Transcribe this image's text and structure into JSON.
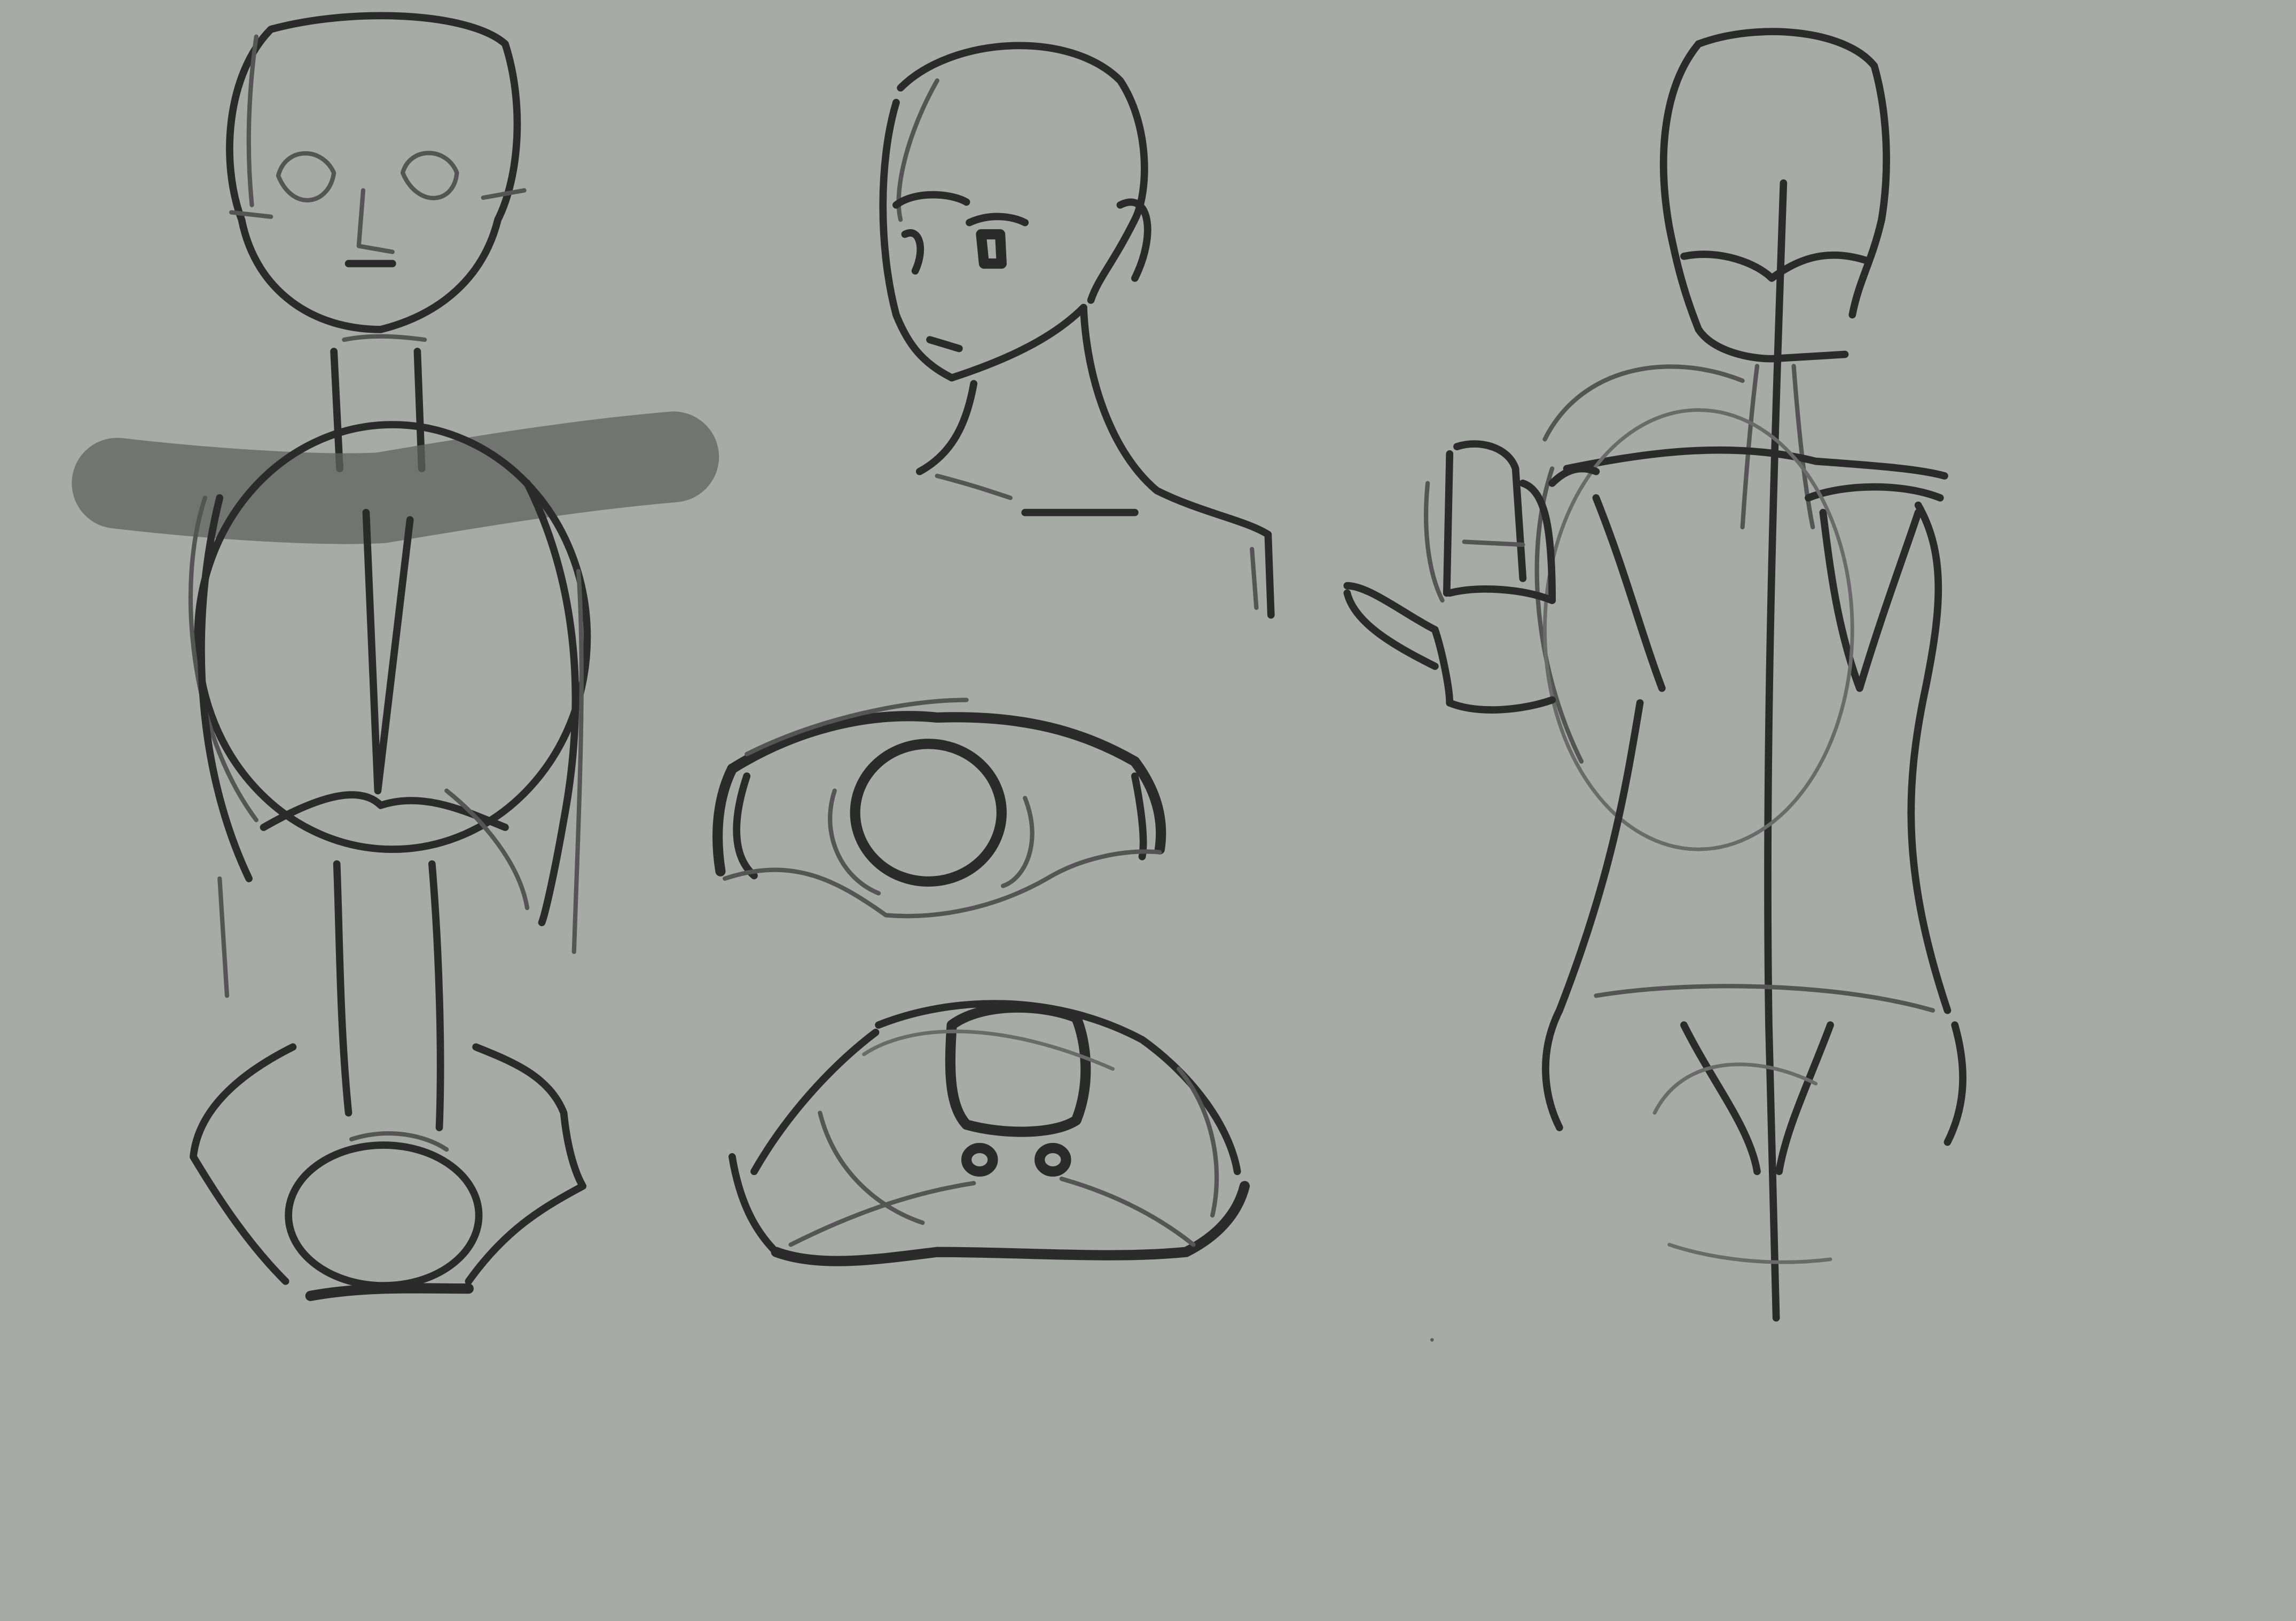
{
  "canvas": {
    "background_color": "#a7aba6",
    "ink_color": "#2b2b2b",
    "smudge_color": "#5f625f"
  },
  "sketches": [
    {
      "id": "front-torso-figure"
    },
    {
      "id": "three-quarter-head"
    },
    {
      "id": "top-ribcage-section"
    },
    {
      "id": "pelvis-top-section"
    },
    {
      "id": "back-view-figure"
    }
  ]
}
